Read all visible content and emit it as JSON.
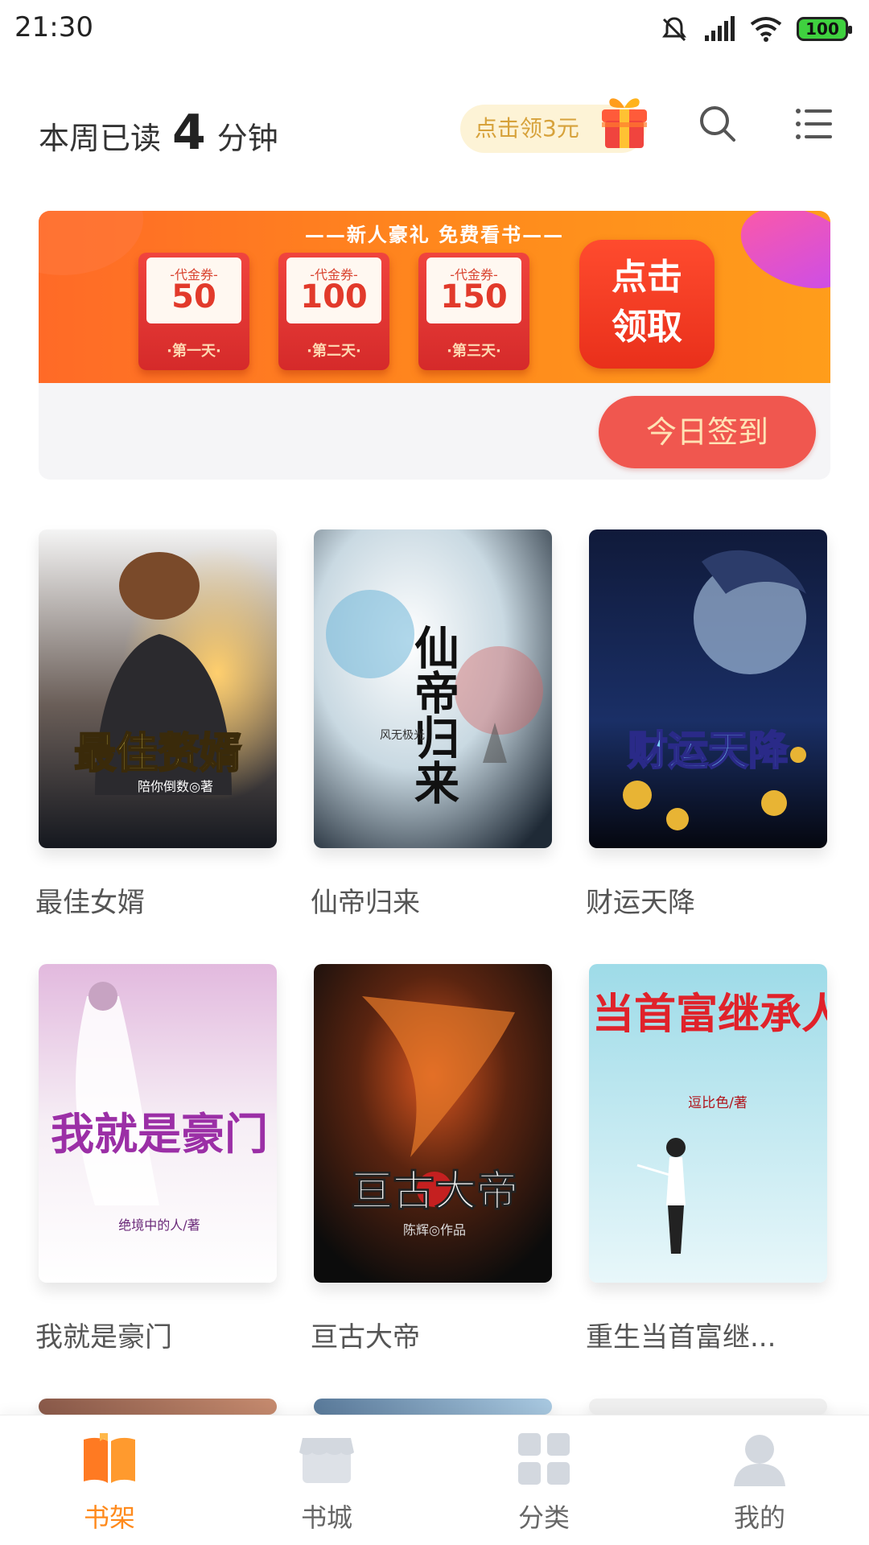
{
  "status_bar": {
    "time": "21:30",
    "battery": "100"
  },
  "header": {
    "read_prefix": "本周已读",
    "read_minutes": "4",
    "read_suffix": "分钟",
    "coupon_label": "点击领3元"
  },
  "banner": {
    "title": "——新人豪礼 免费看书——",
    "vouchers": [
      {
        "label": "-代金券-",
        "amount": "50",
        "day": "·第一天·"
      },
      {
        "label": "-代金券-",
        "amount": "100",
        "day": "·第二天·"
      },
      {
        "label": "-代金券-",
        "amount": "150",
        "day": "·第三天·"
      }
    ],
    "claim_line1": "点击",
    "claim_line2": "领取",
    "checkin_label": "今日签到"
  },
  "books": [
    {
      "title": "最佳女婿",
      "cover_text": "最佳赘婿",
      "cover_author": "陪你倒数◎著"
    },
    {
      "title": "仙帝归来",
      "cover_text": "仙帝归来",
      "cover_author": "风无极光"
    },
    {
      "title": "财运天降",
      "cover_text": "财运天降",
      "cover_author": ""
    },
    {
      "title": "我就是豪门",
      "cover_text": "我就是豪门",
      "cover_author": "绝境中的人/著"
    },
    {
      "title": "亘古大帝",
      "cover_text": "亘古大帝",
      "cover_author": "陈辉◎作品"
    },
    {
      "title": "重生当首富继...",
      "cover_text": "当首富继承人",
      "cover_author": "逗比色/著"
    }
  ],
  "bottom_nav": [
    {
      "label": "书架",
      "active": true
    },
    {
      "label": "书城",
      "active": false
    },
    {
      "label": "分类",
      "active": false
    },
    {
      "label": "我的",
      "active": false
    }
  ],
  "colors": {
    "accent": "#ff8a1c",
    "checkin": "#f0574f",
    "coupon_text": "#d7a23b"
  }
}
